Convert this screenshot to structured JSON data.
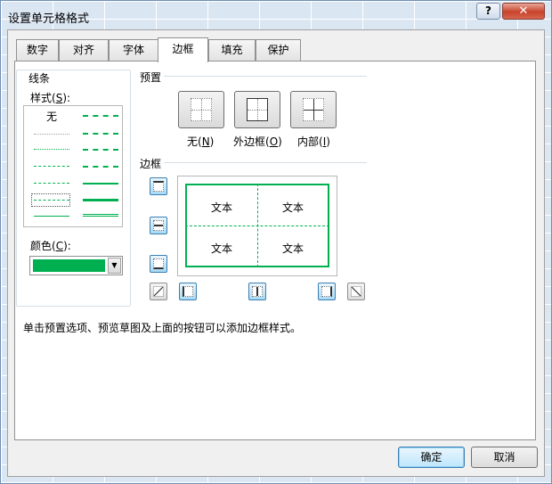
{
  "window": {
    "title": "设置单元格格式",
    "help_label": "?",
    "close_label": "✕"
  },
  "tabs": [
    {
      "label": "数字",
      "active": false
    },
    {
      "label": "对齐",
      "active": false
    },
    {
      "label": "字体",
      "active": false
    },
    {
      "label": "边框",
      "active": true
    },
    {
      "label": "填充",
      "active": false
    },
    {
      "label": "保护",
      "active": false
    }
  ],
  "line_group": {
    "title": "线条",
    "style_label": "样式(",
    "style_key": "S",
    "style_tail": "):",
    "none_label": "无",
    "color_label": "颜色(",
    "color_key": "C",
    "color_tail": "):",
    "selected_color": "#00b050"
  },
  "presets": {
    "title": "预置",
    "items": [
      {
        "label": "无(",
        "key": "N",
        "tail": ")"
      },
      {
        "label": "外边框(",
        "key": "O",
        "tail": ")"
      },
      {
        "label": "内部(",
        "key": "I",
        "tail": ")"
      }
    ]
  },
  "border": {
    "title": "边框",
    "cells": [
      "文本",
      "文本",
      "文本",
      "文本"
    ]
  },
  "hint": "单击预置选项、预览草图及上面的按钮可以添加边框样式。",
  "buttons": {
    "ok": "确定",
    "cancel": "取消"
  }
}
